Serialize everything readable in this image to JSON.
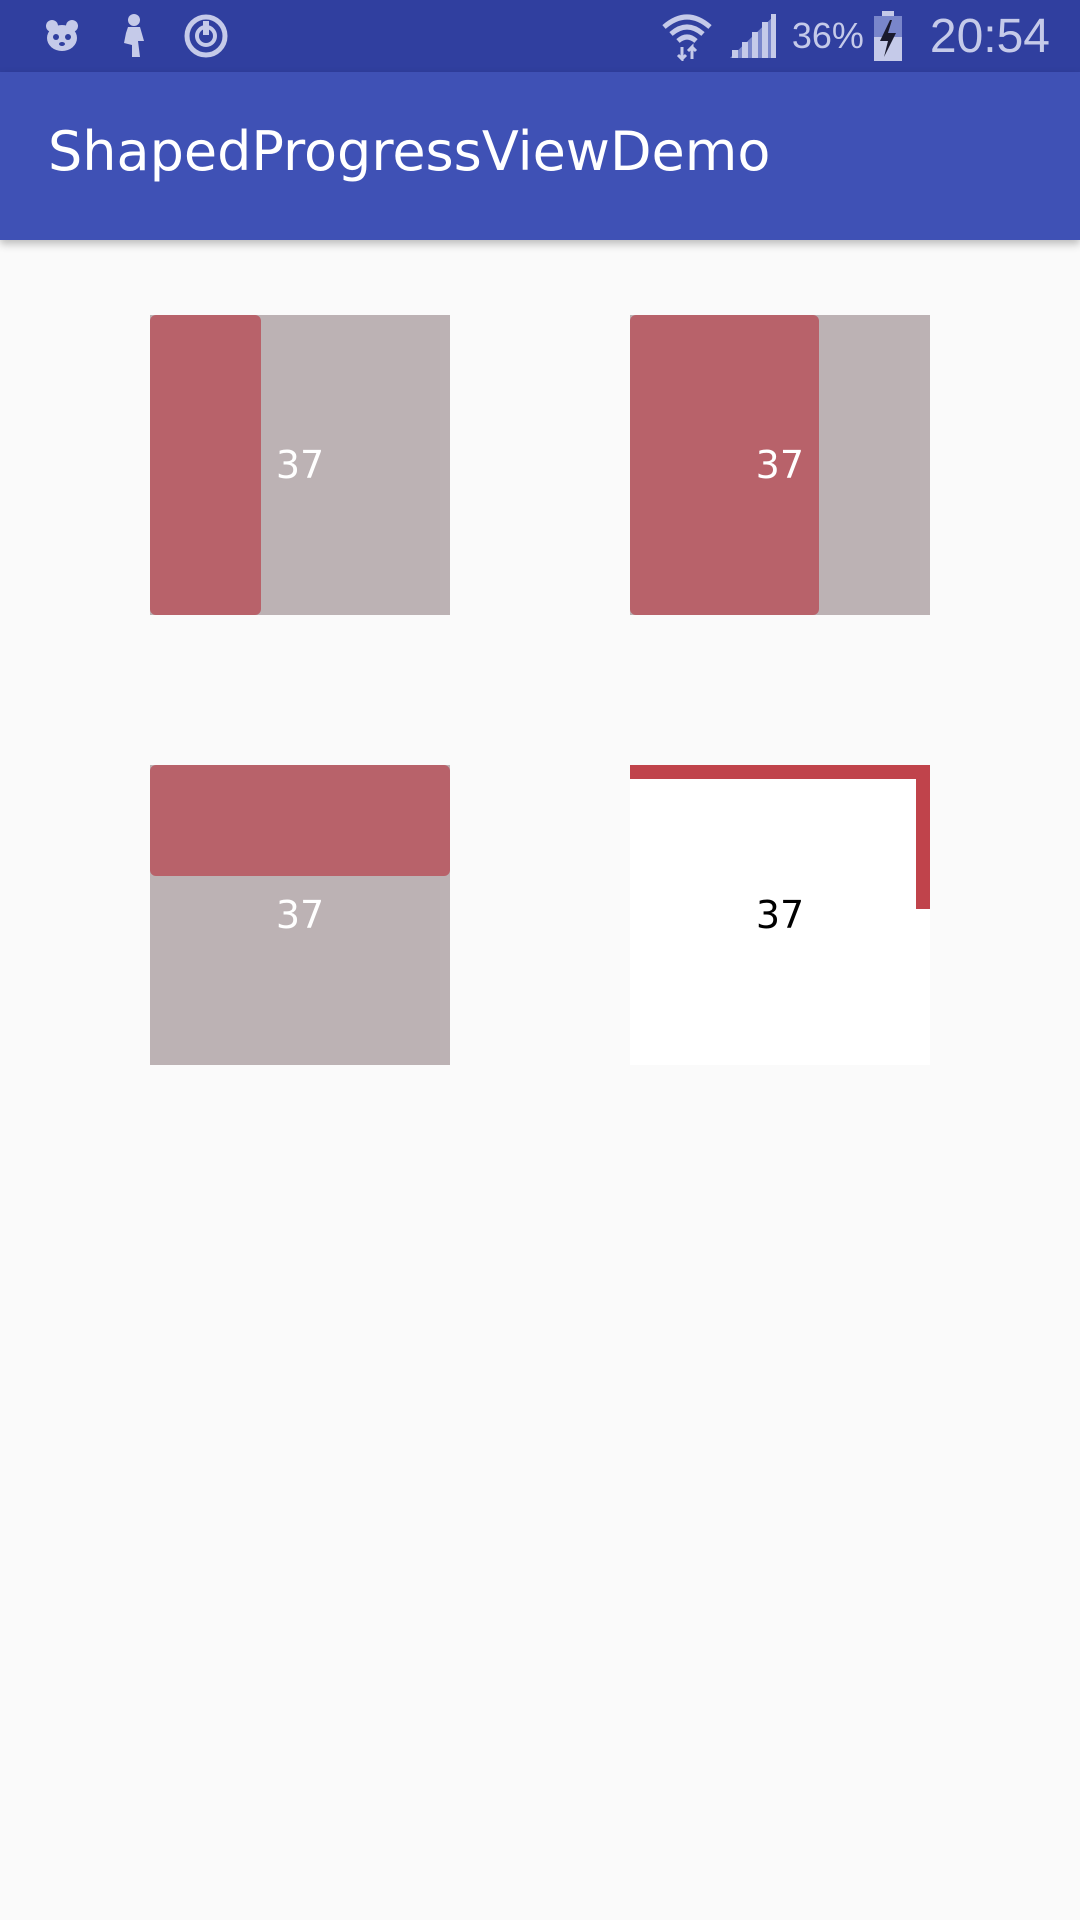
{
  "status_bar": {
    "left_icons": [
      "panda-icon",
      "figure-icon",
      "sync-circle-icon"
    ],
    "battery_percent": "36%",
    "time": "20:54"
  },
  "app_bar": {
    "title": "ShapedProgressViewDemo"
  },
  "progress_views": [
    {
      "value": "37",
      "progress_fraction": 0.37,
      "fill_direction": "left-to-right"
    },
    {
      "value": "37",
      "progress_fraction": 0.63,
      "fill_direction": "left-to-right"
    },
    {
      "value": "37",
      "progress_fraction": 0.37,
      "fill_direction": "top-to-bottom"
    },
    {
      "value": "37",
      "progress_fraction": 0.37,
      "fill_direction": "perimeter-clockwise"
    }
  ],
  "colors": {
    "status_bar": "#303f9f",
    "app_bar": "#3f51b5",
    "progress_fill": "#b8626a",
    "progress_track": "#bcb2b4",
    "border_progress": "#c0434b",
    "background": "#fafafa"
  }
}
